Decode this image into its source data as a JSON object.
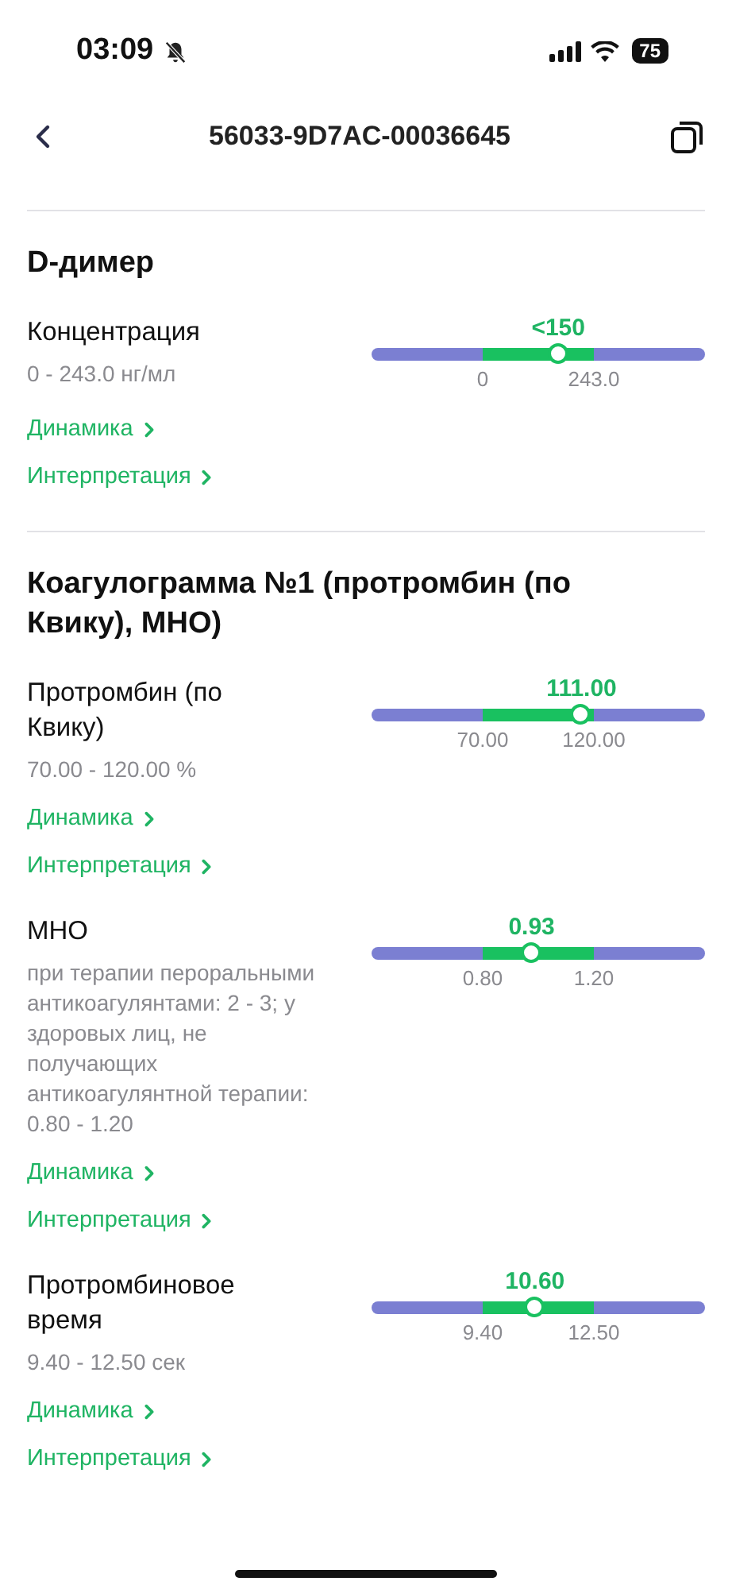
{
  "status_bar": {
    "time": "03:09",
    "battery": "75"
  },
  "header": {
    "title": "56033-9D7AC-00036645"
  },
  "sections": [
    {
      "title": "D-димер",
      "params": [
        {
          "name": "Концентрация",
          "range": "0 - 243.0 нг/мл",
          "value": "<150",
          "level": 0.56,
          "min": "0",
          "max": "243.0",
          "links": [
            "Динамика",
            "Интерпретация"
          ]
        }
      ]
    },
    {
      "title": "Коагулограмма №1 (протромбин (по Квику), МНО)",
      "params": [
        {
          "name": "Протромбин (по Квику)",
          "range": "70.00 - 120.00 %",
          "value": "111.00",
          "level": 0.63,
          "min": "70.00",
          "max": "120.00",
          "links": [
            "Динамика",
            "Интерпретация"
          ]
        },
        {
          "name": "МНО",
          "range": "при терапии пероральными антикоагулянтами: 2 - 3; у здоровых лиц, не получающих антикоагулянтной терапии: 0.80 - 1.20",
          "value": "0.93",
          "level": 0.48,
          "min": "0.80",
          "max": "1.20",
          "links": [
            "Динамика",
            "Интерпретация"
          ]
        },
        {
          "name": "Протромбиновое время",
          "range": "9.40 - 12.50 сек",
          "value": "10.60",
          "level": 0.49,
          "min": "9.40",
          "max": "12.50",
          "links": [
            "Динамика",
            "Интерпретация"
          ]
        }
      ]
    }
  ]
}
